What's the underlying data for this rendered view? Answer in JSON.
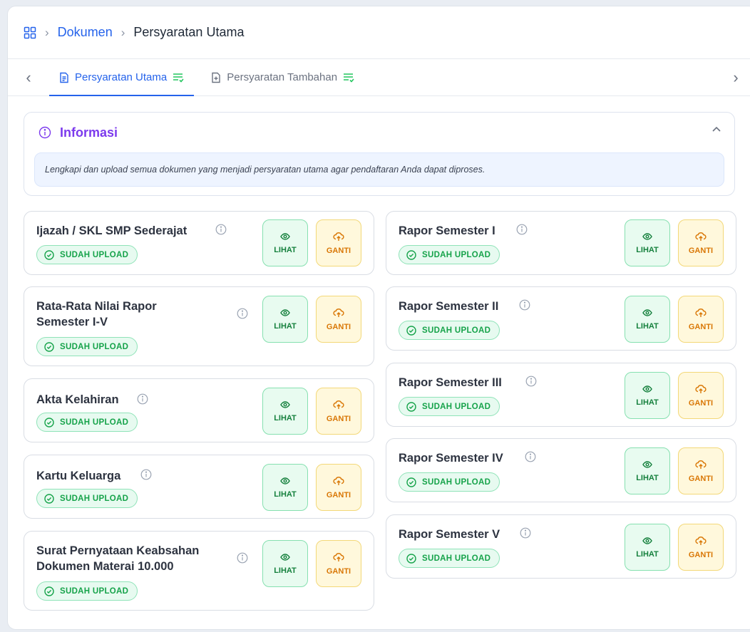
{
  "breadcrumb": {
    "home_icon": "grid-icon",
    "items": [
      "Dokumen",
      "Persyaratan Utama"
    ]
  },
  "tabs": [
    {
      "label": "Persyaratan Utama",
      "active": true
    },
    {
      "label": "Persyaratan Tambahan",
      "active": false
    }
  ],
  "info": {
    "title": "Informasi",
    "text": "Lengkapi dan upload semua dokumen yang menjadi persyaratan utama agar pendaftaran Anda dapat diproses."
  },
  "buttons": {
    "view": "LIHAT",
    "replace": "GANTI"
  },
  "documents_left": [
    {
      "title": "Ijazah / SKL SMP Sederajat",
      "status": "SUDAH UPLOAD"
    },
    {
      "title": "Rata-Rata Nilai Rapor Semester I-V",
      "status": "SUDAH UPLOAD"
    },
    {
      "title": "Akta Kelahiran",
      "status": "SUDAH UPLOAD"
    },
    {
      "title": "Kartu Keluarga",
      "status": "SUDAH UPLOAD"
    },
    {
      "title": "Surat Pernyataan Keabsahan Dokumen Materai 10.000",
      "status": "SUDAH UPLOAD"
    }
  ],
  "documents_right": [
    {
      "title": "Rapor Semester I",
      "status": "SUDAH UPLOAD"
    },
    {
      "title": "Rapor Semester II",
      "status": "SUDAH UPLOAD"
    },
    {
      "title": "Rapor Semester III",
      "status": "SUDAH UPLOAD"
    },
    {
      "title": "Rapor Semester IV",
      "status": "SUDAH UPLOAD"
    },
    {
      "title": "Rapor Semester V",
      "status": "SUDAH UPLOAD"
    }
  ],
  "colors": {
    "primary": "#2563eb",
    "success": "#16a34a",
    "warning": "#d97706",
    "info_title": "#7c3aed"
  }
}
